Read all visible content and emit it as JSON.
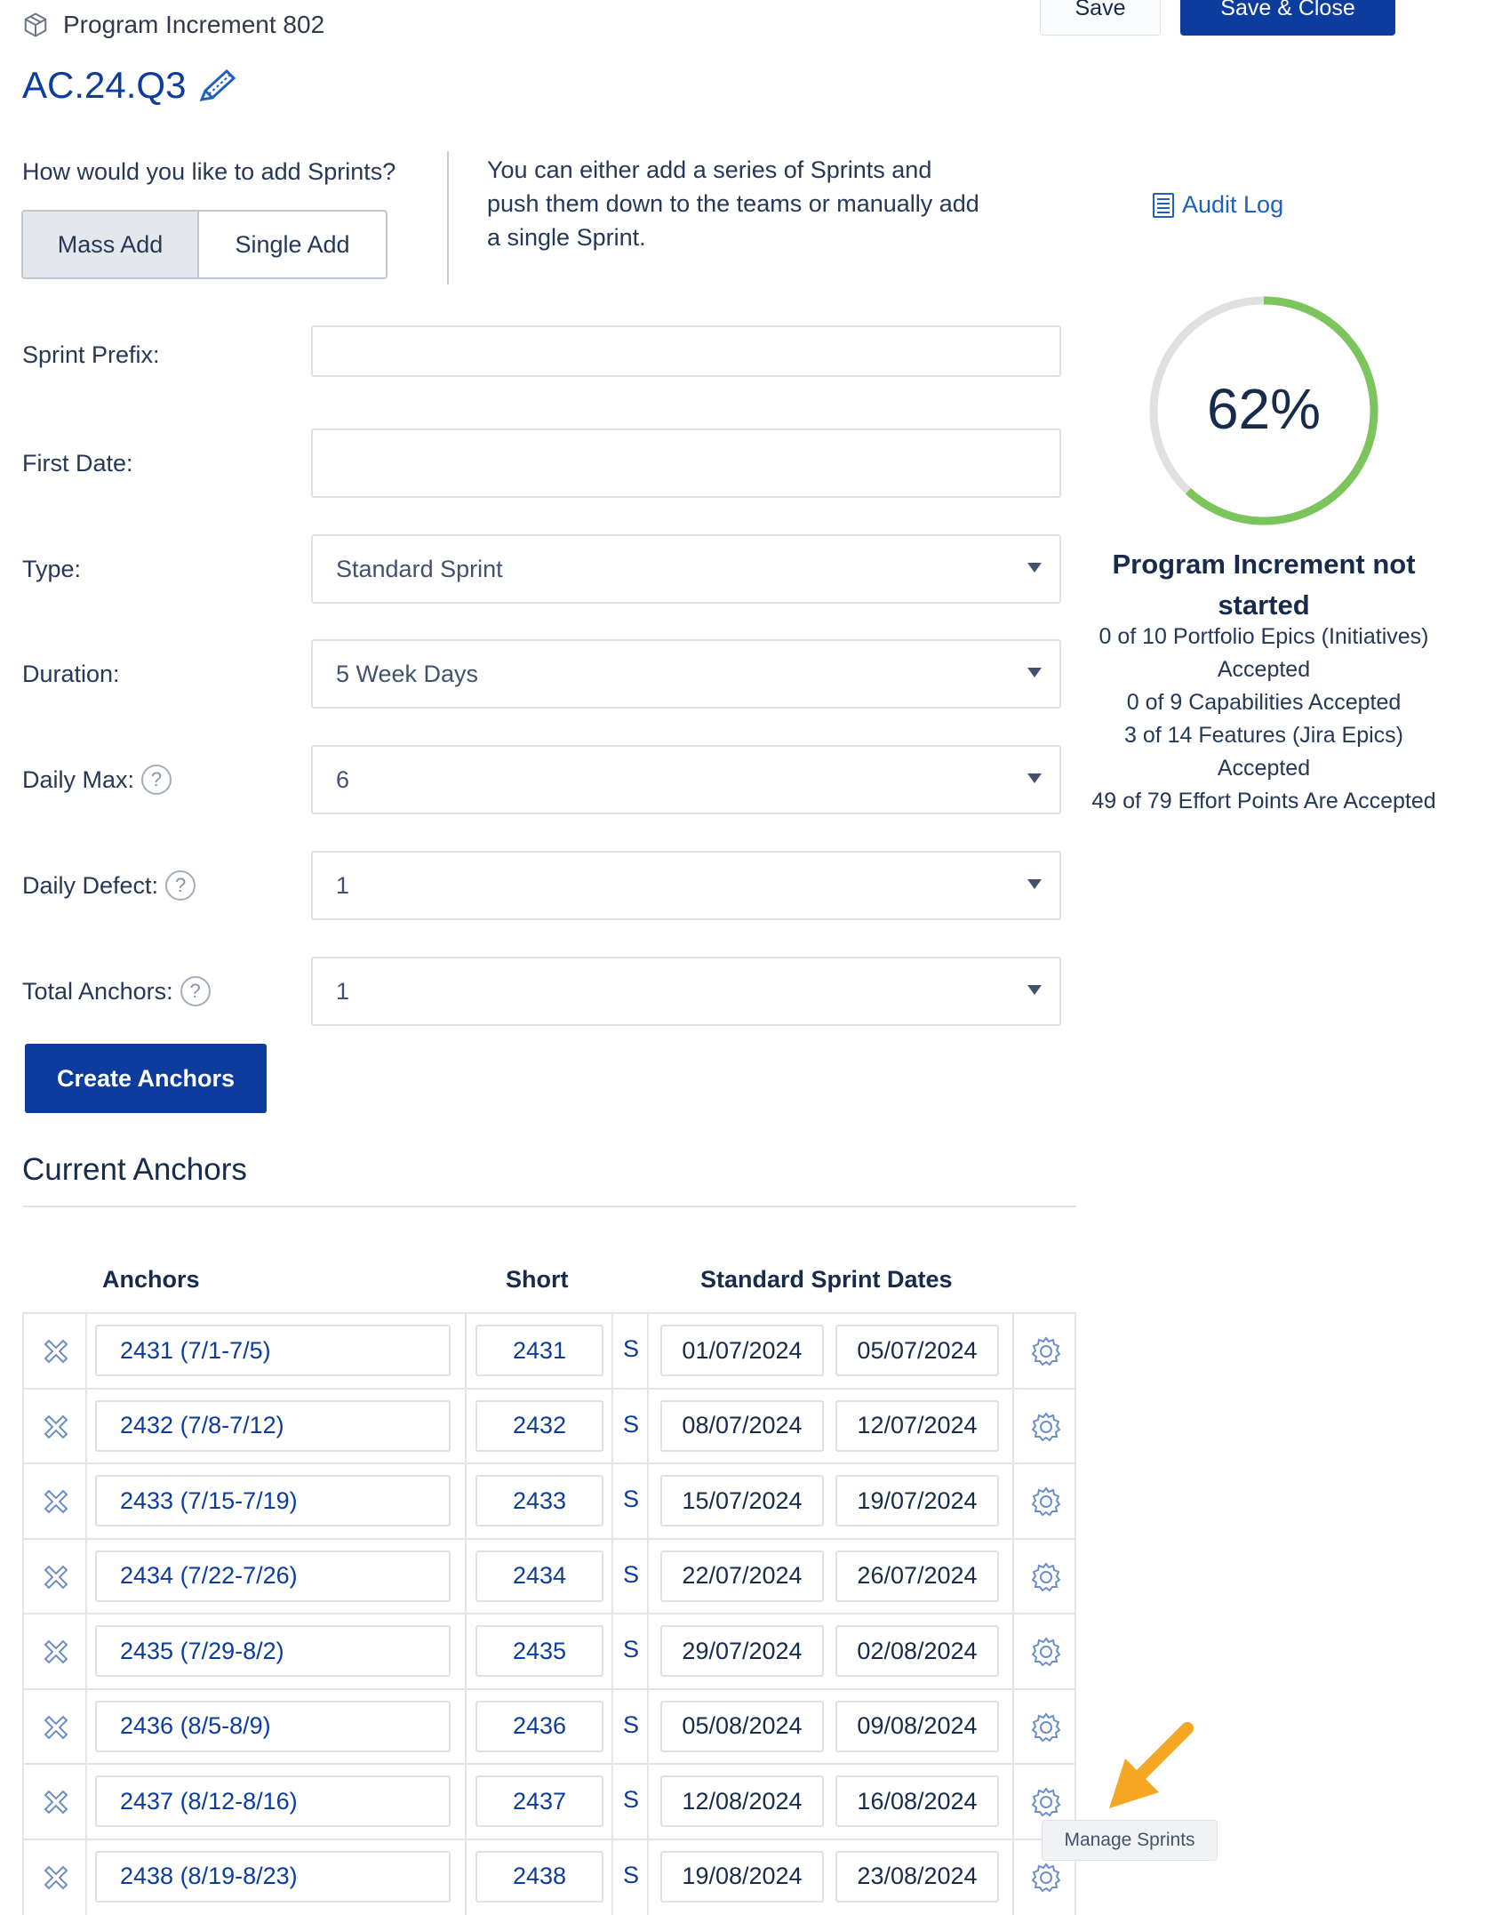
{
  "header": {
    "icon": "cube-icon",
    "program_increment": "Program Increment 802",
    "title": "AC.24.Q3",
    "edit_icon": "pencil-icon",
    "save_label": "Save",
    "save_close_label": "Save & Close"
  },
  "add_mode": {
    "question": "How would you like to add Sprints?",
    "options": [
      "Mass Add",
      "Single Add"
    ],
    "selected": "Mass Add",
    "hint": "You can either add a series of Sprints and push them down to the teams or manually add a single Sprint."
  },
  "audit_log": {
    "label": "Audit Log",
    "icon": "document-icon"
  },
  "form": {
    "sprint_prefix": {
      "label": "Sprint Prefix:",
      "value": ""
    },
    "first_date": {
      "label": "First Date:",
      "value": ""
    },
    "type": {
      "label": "Type:",
      "value": "Standard Sprint"
    },
    "duration": {
      "label": "Duration:",
      "value": "5 Week Days"
    },
    "daily_max": {
      "label": "Daily Max:",
      "value": "6"
    },
    "daily_defect": {
      "label": "Daily Defect:",
      "value": "1"
    },
    "total_anchors": {
      "label": "Total Anchors:",
      "value": "1"
    },
    "help_glyph": "?",
    "create_label": "Create Anchors"
  },
  "progress": {
    "percent_label": "62%",
    "percent": 62,
    "ring_color": "#7cc45c",
    "track_color": "#e0e0e0",
    "status": "Program Increment not started",
    "lines": [
      "0 of 10 Portfolio Epics (Initiatives) Accepted",
      "0 of 9  Capabilities Accepted",
      "3 of 14  Features (Jira Epics) Accepted",
      "49 of 79 Effort Points Are Accepted"
    ]
  },
  "anchors": {
    "title": "Current Anchors",
    "columns": {
      "anchors": "Anchors",
      "short": "Short",
      "dates": "Standard Sprint Dates"
    },
    "rows": [
      {
        "name": "2431 (7/1-7/5)",
        "short": "2431",
        "type": "S",
        "start": "01/07/2024",
        "end": "05/07/2024"
      },
      {
        "name": "2432 (7/8-7/12)",
        "short": "2432",
        "type": "S",
        "start": "08/07/2024",
        "end": "12/07/2024"
      },
      {
        "name": "2433 (7/15-7/19)",
        "short": "2433",
        "type": "S",
        "start": "15/07/2024",
        "end": "19/07/2024"
      },
      {
        "name": "2434 (7/22-7/26)",
        "short": "2434",
        "type": "S",
        "start": "22/07/2024",
        "end": "26/07/2024"
      },
      {
        "name": "2435 (7/29-8/2)",
        "short": "2435",
        "type": "S",
        "start": "29/07/2024",
        "end": "02/08/2024"
      },
      {
        "name": "2436 (8/5-8/9)",
        "short": "2436",
        "type": "S",
        "start": "05/08/2024",
        "end": "09/08/2024"
      },
      {
        "name": "2437 (8/12-8/16)",
        "short": "2437",
        "type": "S",
        "start": "12/08/2024",
        "end": "16/08/2024"
      },
      {
        "name": "2438 (8/19-8/23)",
        "short": "2438",
        "type": "S",
        "start": "19/08/2024",
        "end": "23/08/2024"
      }
    ]
  },
  "tooltip": {
    "label": "Manage Sprints",
    "arrow_color": "#f5a623"
  }
}
